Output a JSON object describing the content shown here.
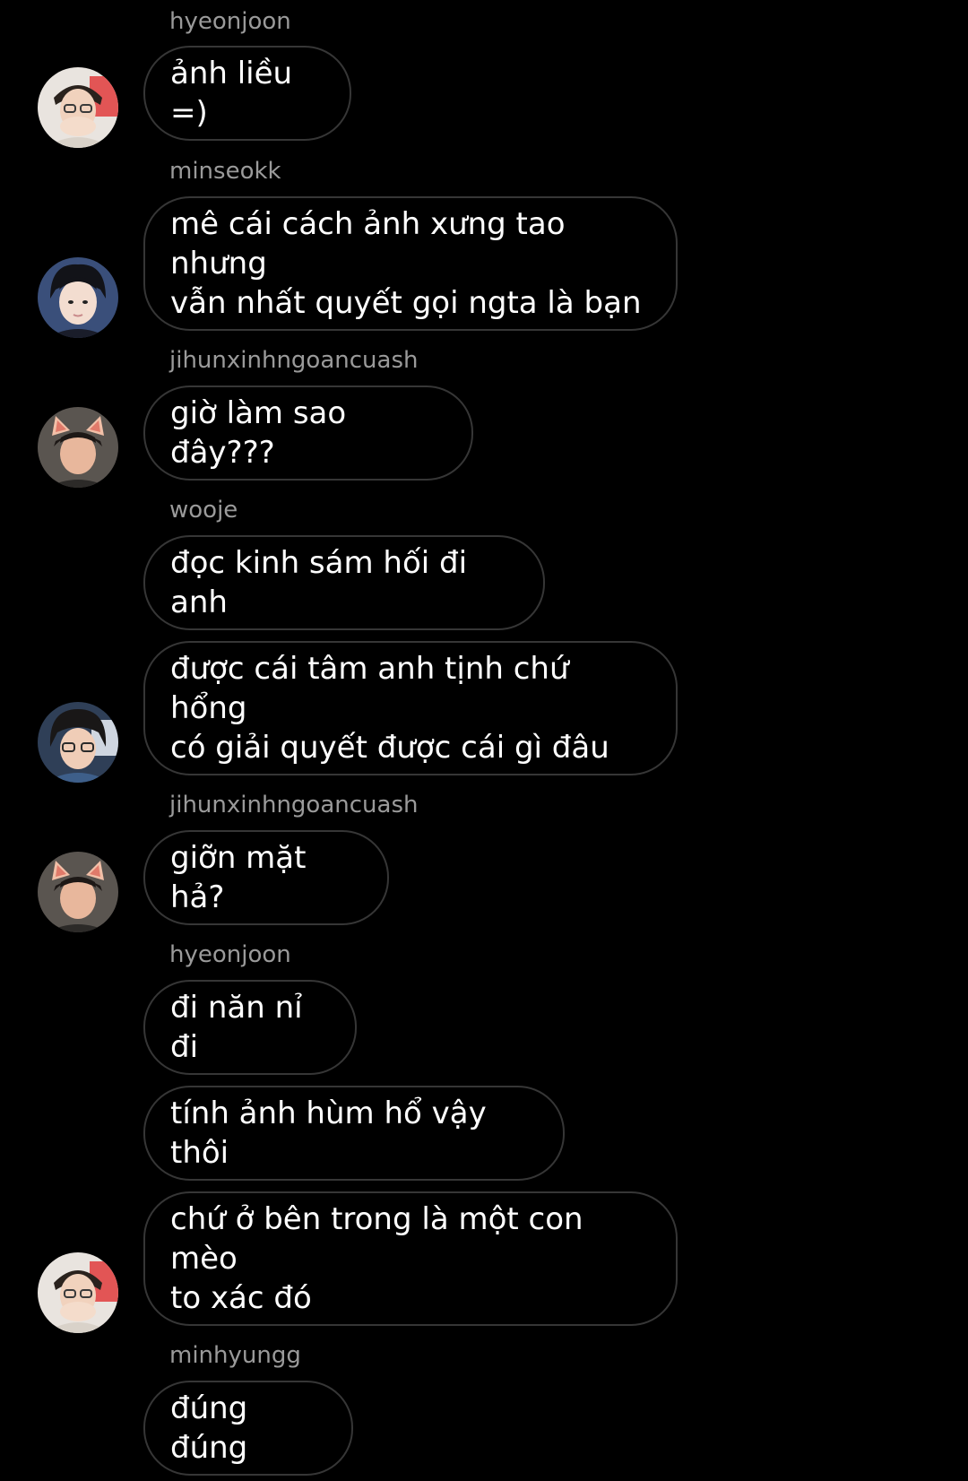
{
  "messages": [
    {
      "username": "hyeonjoon",
      "text": "ảnh liều =)"
    },
    {
      "username": "minseokk",
      "text": "mê cái cách ảnh xưng tao nhưng\nvẫn nhất quyết gọi ngta là bạn"
    },
    {
      "username": "jihunxinhngoancuash",
      "text": "giờ làm sao đây???"
    },
    {
      "username": "wooje",
      "text": "đọc kinh sám hối đi anh"
    },
    {
      "text": "được cái tâm anh tịnh chứ hổng\ncó giải quyết được cái gì đâu"
    },
    {
      "username": "jihunxinhngoancuash",
      "text": "giỡn mặt hả?"
    },
    {
      "username": "hyeonjoon",
      "text": "đi năn nỉ đi"
    },
    {
      "text": "tính ảnh hùm hổ vậy thôi"
    },
    {
      "text": "chứ ở bên trong là một con mèo\nto xác đó"
    },
    {
      "username": "minhyungg",
      "text": "đúng đúng"
    }
  ],
  "avatars": [
    {
      "user": "hyeonjoon",
      "icon": "avatar-hyeonjoon-photo"
    },
    {
      "user": "minseokk",
      "icon": "avatar-minseokk-photo"
    },
    {
      "user": "jihunxinhngoancuash",
      "icon": "avatar-jihun-photo"
    },
    {
      "user": "wooje",
      "icon": "avatar-wooje-photo"
    },
    {
      "user": "jihunxinhngoancuash",
      "icon": "avatar-jihun-photo"
    },
    {
      "user": "hyeonjoon",
      "icon": "avatar-hyeonjoon-photo"
    }
  ],
  "colors": {
    "background": "#000000",
    "bubble_border": "#363636",
    "username": "#9a9a9a",
    "message_text": "#ffffff"
  }
}
